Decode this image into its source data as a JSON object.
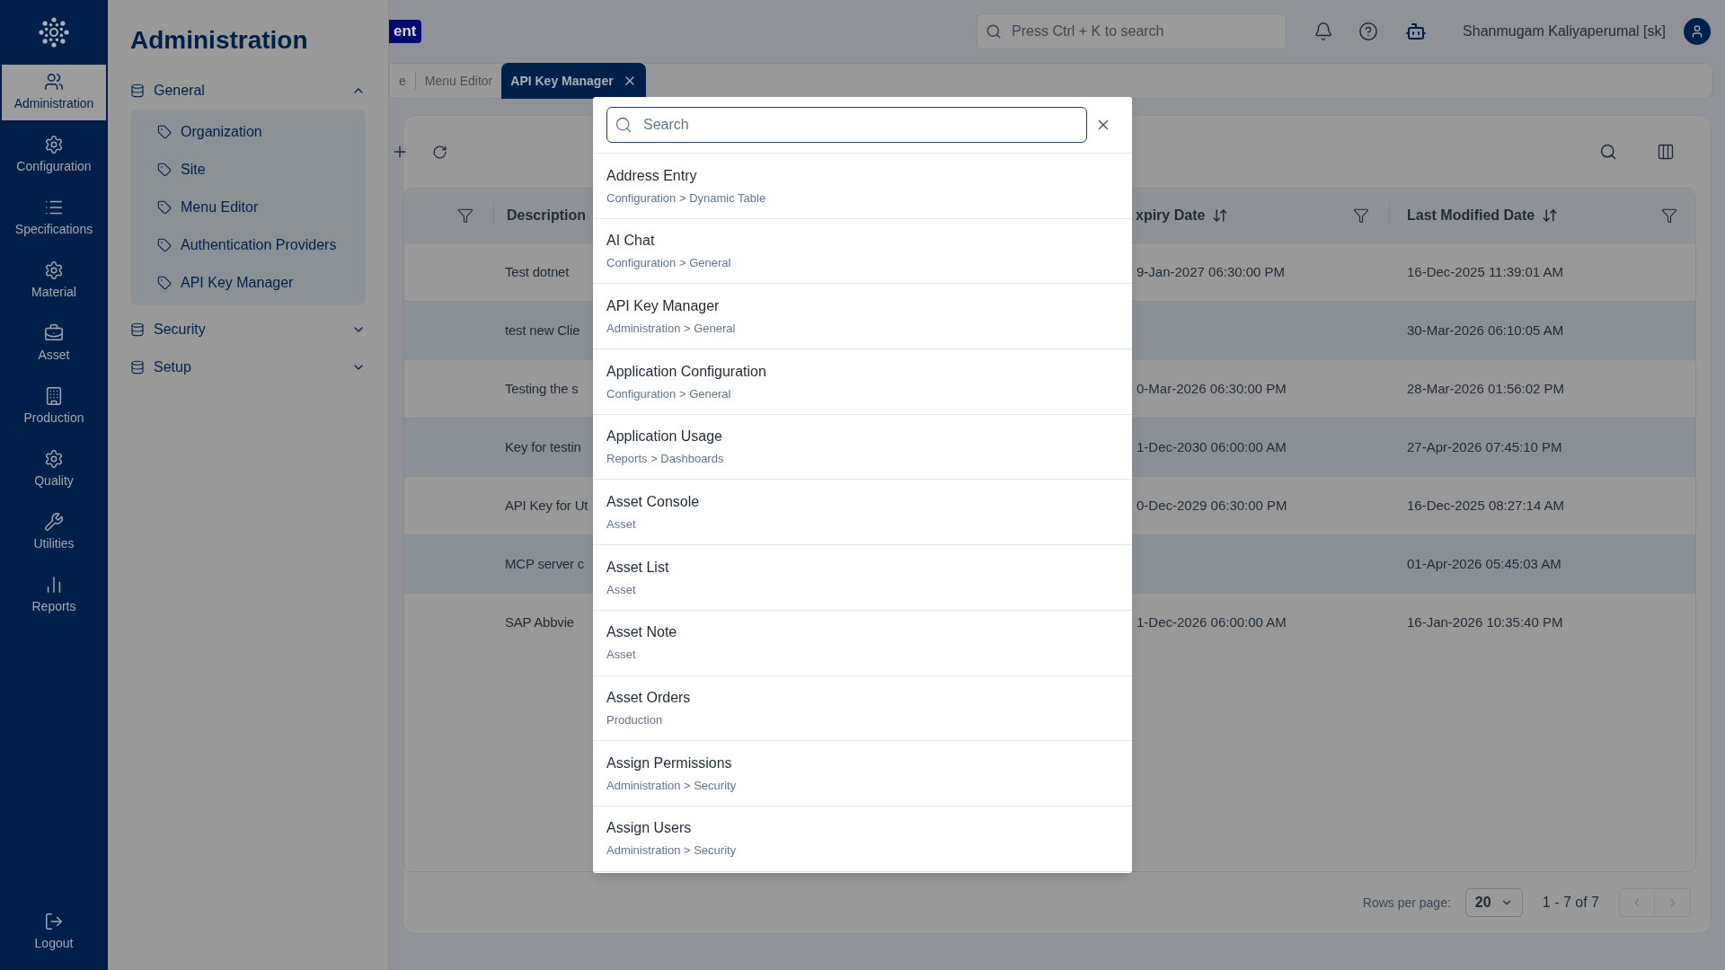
{
  "app_rail": {
    "items": [
      {
        "label": "Administration",
        "selected": true
      },
      {
        "label": "Configuration",
        "selected": false
      },
      {
        "label": "Specifications",
        "selected": false
      },
      {
        "label": "Material",
        "selected": false
      },
      {
        "label": "Asset",
        "selected": false
      },
      {
        "label": "Production",
        "selected": false
      },
      {
        "label": "Quality",
        "selected": false
      },
      {
        "label": "Utilities",
        "selected": false
      },
      {
        "label": "Reports",
        "selected": false
      }
    ],
    "logout": "Logout"
  },
  "admin_panel": {
    "title": "Administration",
    "groups": [
      {
        "label": "General",
        "expanded": true,
        "children": [
          {
            "label": "Organization"
          },
          {
            "label": "Site"
          },
          {
            "label": "Menu Editor"
          },
          {
            "label": "Authentication Providers"
          },
          {
            "label": "API Key Manager"
          }
        ]
      },
      {
        "label": "Security",
        "expanded": false
      },
      {
        "label": "Setup",
        "expanded": false
      }
    ]
  },
  "header": {
    "badge": "ent",
    "search": {
      "placeholder": "Press Ctrl + K to search"
    },
    "user": "Shanmugam Kaliyaperumal [sk]"
  },
  "tabs": [
    {
      "label": "e",
      "selected": false,
      "closable": false
    },
    {
      "label": "Menu Editor",
      "selected": false,
      "closable": false
    },
    {
      "label": "API Key Manager",
      "selected": true,
      "closable": true
    }
  ],
  "table": {
    "columns": [
      {
        "label": "Description",
        "sortable": false
      },
      {
        "label": "xpiry Date",
        "sortable": true
      },
      {
        "label": "Last Modified Date",
        "sortable": true
      }
    ],
    "rows": [
      {
        "description": "Test dotnet",
        "expiry": "9-Jan-2027 06:30:00 PM",
        "modified": "16-Dec-2025 11:39:01 AM"
      },
      {
        "description": "test new Clie",
        "modified": "30-Mar-2026 06:10:05 AM"
      },
      {
        "description": "Testing the s",
        "expiry": "0-Mar-2026 06:30:00 PM",
        "modified": "28-Mar-2026 01:56:02 PM"
      },
      {
        "description": "Key for testin",
        "expiry": "1-Dec-2030 06:00:00 AM",
        "modified": "27-Apr-2026 07:45:10 PM"
      },
      {
        "description": "API Key for Ut",
        "expiry": "0-Dec-2029 06:30:00 PM",
        "modified": "16-Dec-2025 08:27:14 AM"
      },
      {
        "description": "MCP server c",
        "modified": "01-Apr-2026 05:45:03 AM"
      },
      {
        "description": "SAP Abbvie",
        "expiry": "1-Dec-2026 06:00:00 AM",
        "modified": "16-Jan-2026 10:35:40 PM"
      }
    ]
  },
  "pagination": {
    "rows_per_page_label": "Rows per page:",
    "rows_per_page": "20",
    "range": "1 - 7 of 7"
  },
  "search_dialog": {
    "placeholder": "Search",
    "results": [
      {
        "title": "Address Entry",
        "path": "Configuration > Dynamic Table"
      },
      {
        "title": "AI Chat",
        "path": "Configuration > General"
      },
      {
        "title": "API Key Manager",
        "path": "Administration > General"
      },
      {
        "title": "Application Configuration",
        "path": "Configuration > General"
      },
      {
        "title": "Application Usage",
        "path": "Reports > Dashboards"
      },
      {
        "title": "Asset Console",
        "path": "Asset"
      },
      {
        "title": "Asset List",
        "path": "Asset"
      },
      {
        "title": "Asset Note",
        "path": "Asset"
      },
      {
        "title": "Asset Orders",
        "path": "Production"
      },
      {
        "title": "Assign Permissions",
        "path": "Administration > Security"
      },
      {
        "title": "Assign Users",
        "path": "Administration > Security"
      }
    ]
  }
}
